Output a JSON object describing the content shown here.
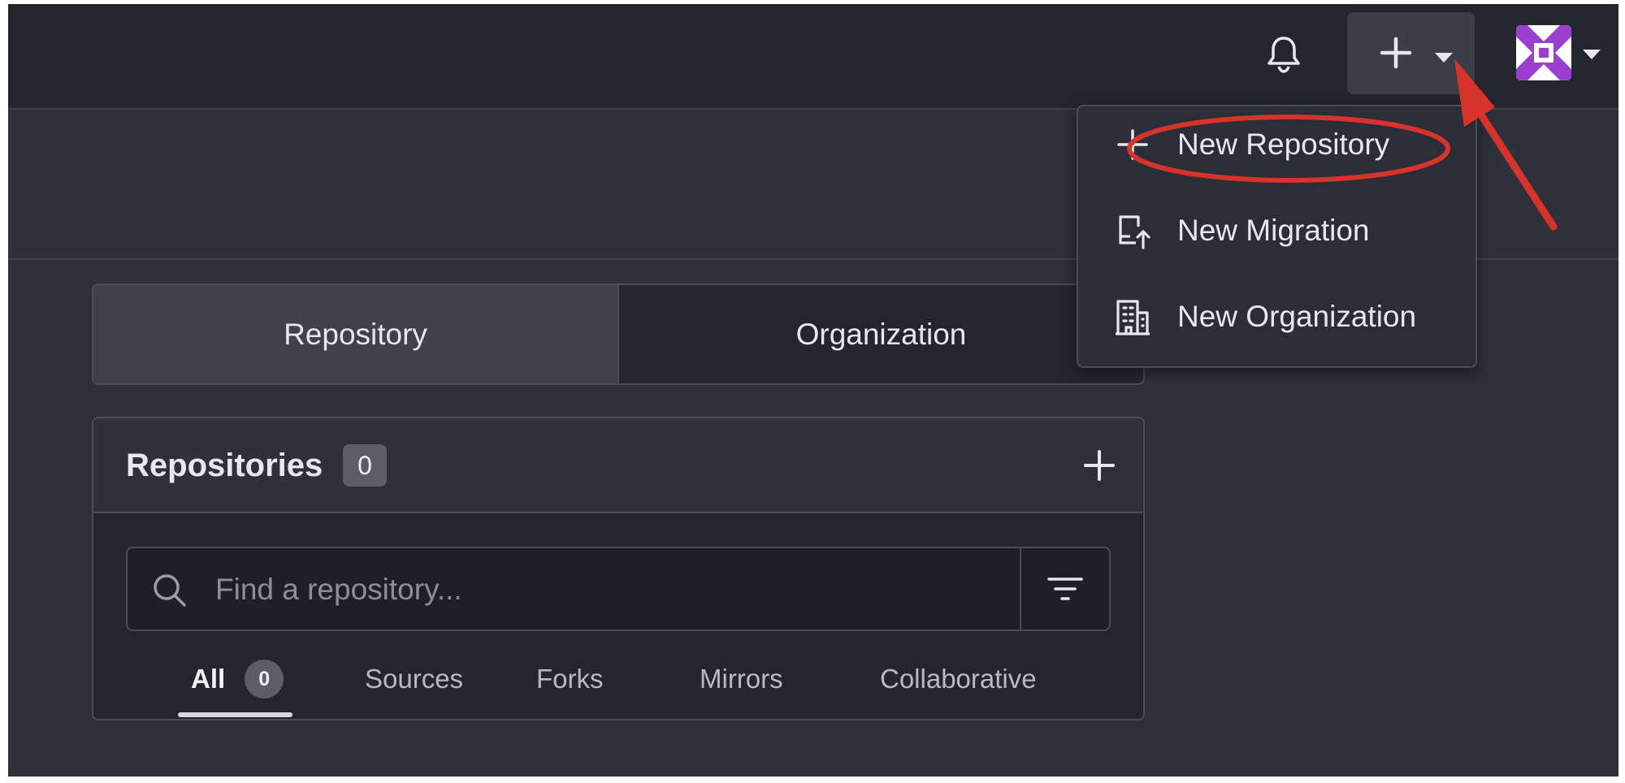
{
  "navbar": {
    "notification_icon": "bell-icon",
    "create_icon": "plus-icon",
    "create_caret_icon": "caret-down-icon",
    "avatar_icon": "avatar-image",
    "avatar_caret_icon": "caret-down-icon"
  },
  "create_menu": {
    "items": [
      {
        "icon": "plus-icon",
        "label": "New Repository"
      },
      {
        "icon": "migration-icon",
        "label": "New Migration"
      },
      {
        "icon": "organization-icon",
        "label": "New Organization"
      }
    ]
  },
  "switcher": {
    "tabs": [
      {
        "label": "Repository",
        "active": true
      },
      {
        "label": "Organization",
        "active": false
      }
    ]
  },
  "repo_panel": {
    "title": "Repositories",
    "count": "0",
    "add_icon": "plus-icon",
    "search": {
      "placeholder": "Find a repository...",
      "value": ""
    },
    "filter_icon": "filter-icon",
    "filter_tabs": [
      {
        "label": "All",
        "count": "0",
        "active": true
      },
      {
        "label": "Sources"
      },
      {
        "label": "Forks"
      },
      {
        "label": "Mirrors"
      },
      {
        "label": "Collaborative"
      }
    ]
  },
  "colors": {
    "background": "#2e303a",
    "navbar": "#23262e",
    "annotation_red": "#d8332b"
  }
}
